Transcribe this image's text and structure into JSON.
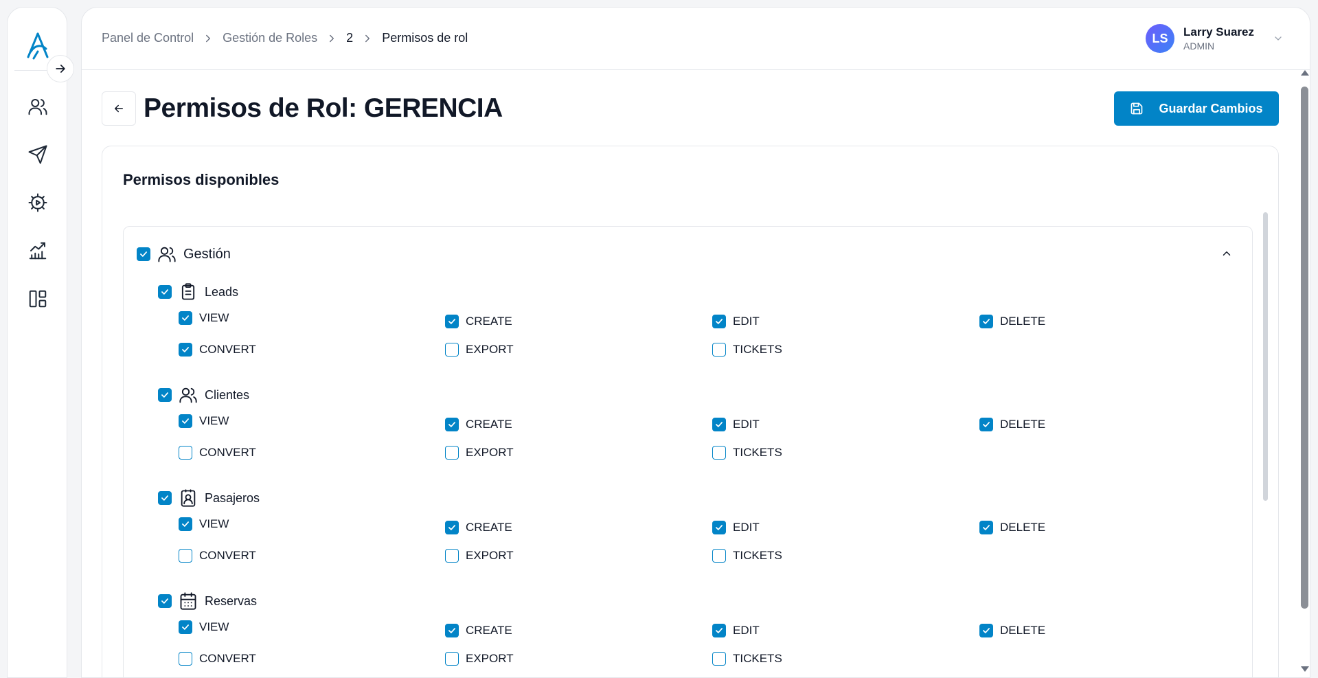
{
  "breadcrumb": {
    "items": [
      "Panel de Control",
      "Gestión de Roles",
      "2",
      "Permisos de rol"
    ]
  },
  "user": {
    "initials": "LS",
    "name": "Larry Suarez",
    "role": "ADMIN"
  },
  "page": {
    "title": "Permisos de Rol: GERENCIA",
    "save_label": "Guardar Cambios"
  },
  "card": {
    "title": "Permisos disponibles"
  },
  "group": {
    "label": "Gestión",
    "checked": true
  },
  "modules": [
    {
      "label": "Leads",
      "icon": "clipboard-list-icon",
      "checked": true,
      "permissions": [
        {
          "label": "VIEW",
          "checked": true
        },
        {
          "label": "CREATE",
          "checked": true
        },
        {
          "label": "EDIT",
          "checked": true
        },
        {
          "label": "DELETE",
          "checked": true
        },
        {
          "label": "CONVERT",
          "checked": true
        },
        {
          "label": "EXPORT",
          "checked": false
        },
        {
          "label": "TICKETS",
          "checked": false
        }
      ]
    },
    {
      "label": "Clientes",
      "icon": "users-icon",
      "checked": true,
      "permissions": [
        {
          "label": "VIEW",
          "checked": true
        },
        {
          "label": "CREATE",
          "checked": true
        },
        {
          "label": "EDIT",
          "checked": true
        },
        {
          "label": "DELETE",
          "checked": true
        },
        {
          "label": "CONVERT",
          "checked": false
        },
        {
          "label": "EXPORT",
          "checked": false
        },
        {
          "label": "TICKETS",
          "checked": false
        }
      ]
    },
    {
      "label": "Pasajeros",
      "icon": "contact-badge-icon",
      "checked": true,
      "permissions": [
        {
          "label": "VIEW",
          "checked": true
        },
        {
          "label": "CREATE",
          "checked": true
        },
        {
          "label": "EDIT",
          "checked": true
        },
        {
          "label": "DELETE",
          "checked": true
        },
        {
          "label": "CONVERT",
          "checked": false
        },
        {
          "label": "EXPORT",
          "checked": false
        },
        {
          "label": "TICKETS",
          "checked": false
        }
      ]
    },
    {
      "label": "Reservas",
      "icon": "calendar-icon",
      "checked": true,
      "permissions": [
        {
          "label": "VIEW",
          "checked": true
        },
        {
          "label": "CREATE",
          "checked": true
        },
        {
          "label": "EDIT",
          "checked": true
        },
        {
          "label": "DELETE",
          "checked": true
        },
        {
          "label": "CONVERT",
          "checked": false
        },
        {
          "label": "EXPORT",
          "checked": false
        },
        {
          "label": "TICKETS",
          "checked": false
        }
      ]
    }
  ],
  "colors": {
    "accent": "#0284c7",
    "border": "#e5e7eb",
    "muted_text": "#6b7280"
  }
}
